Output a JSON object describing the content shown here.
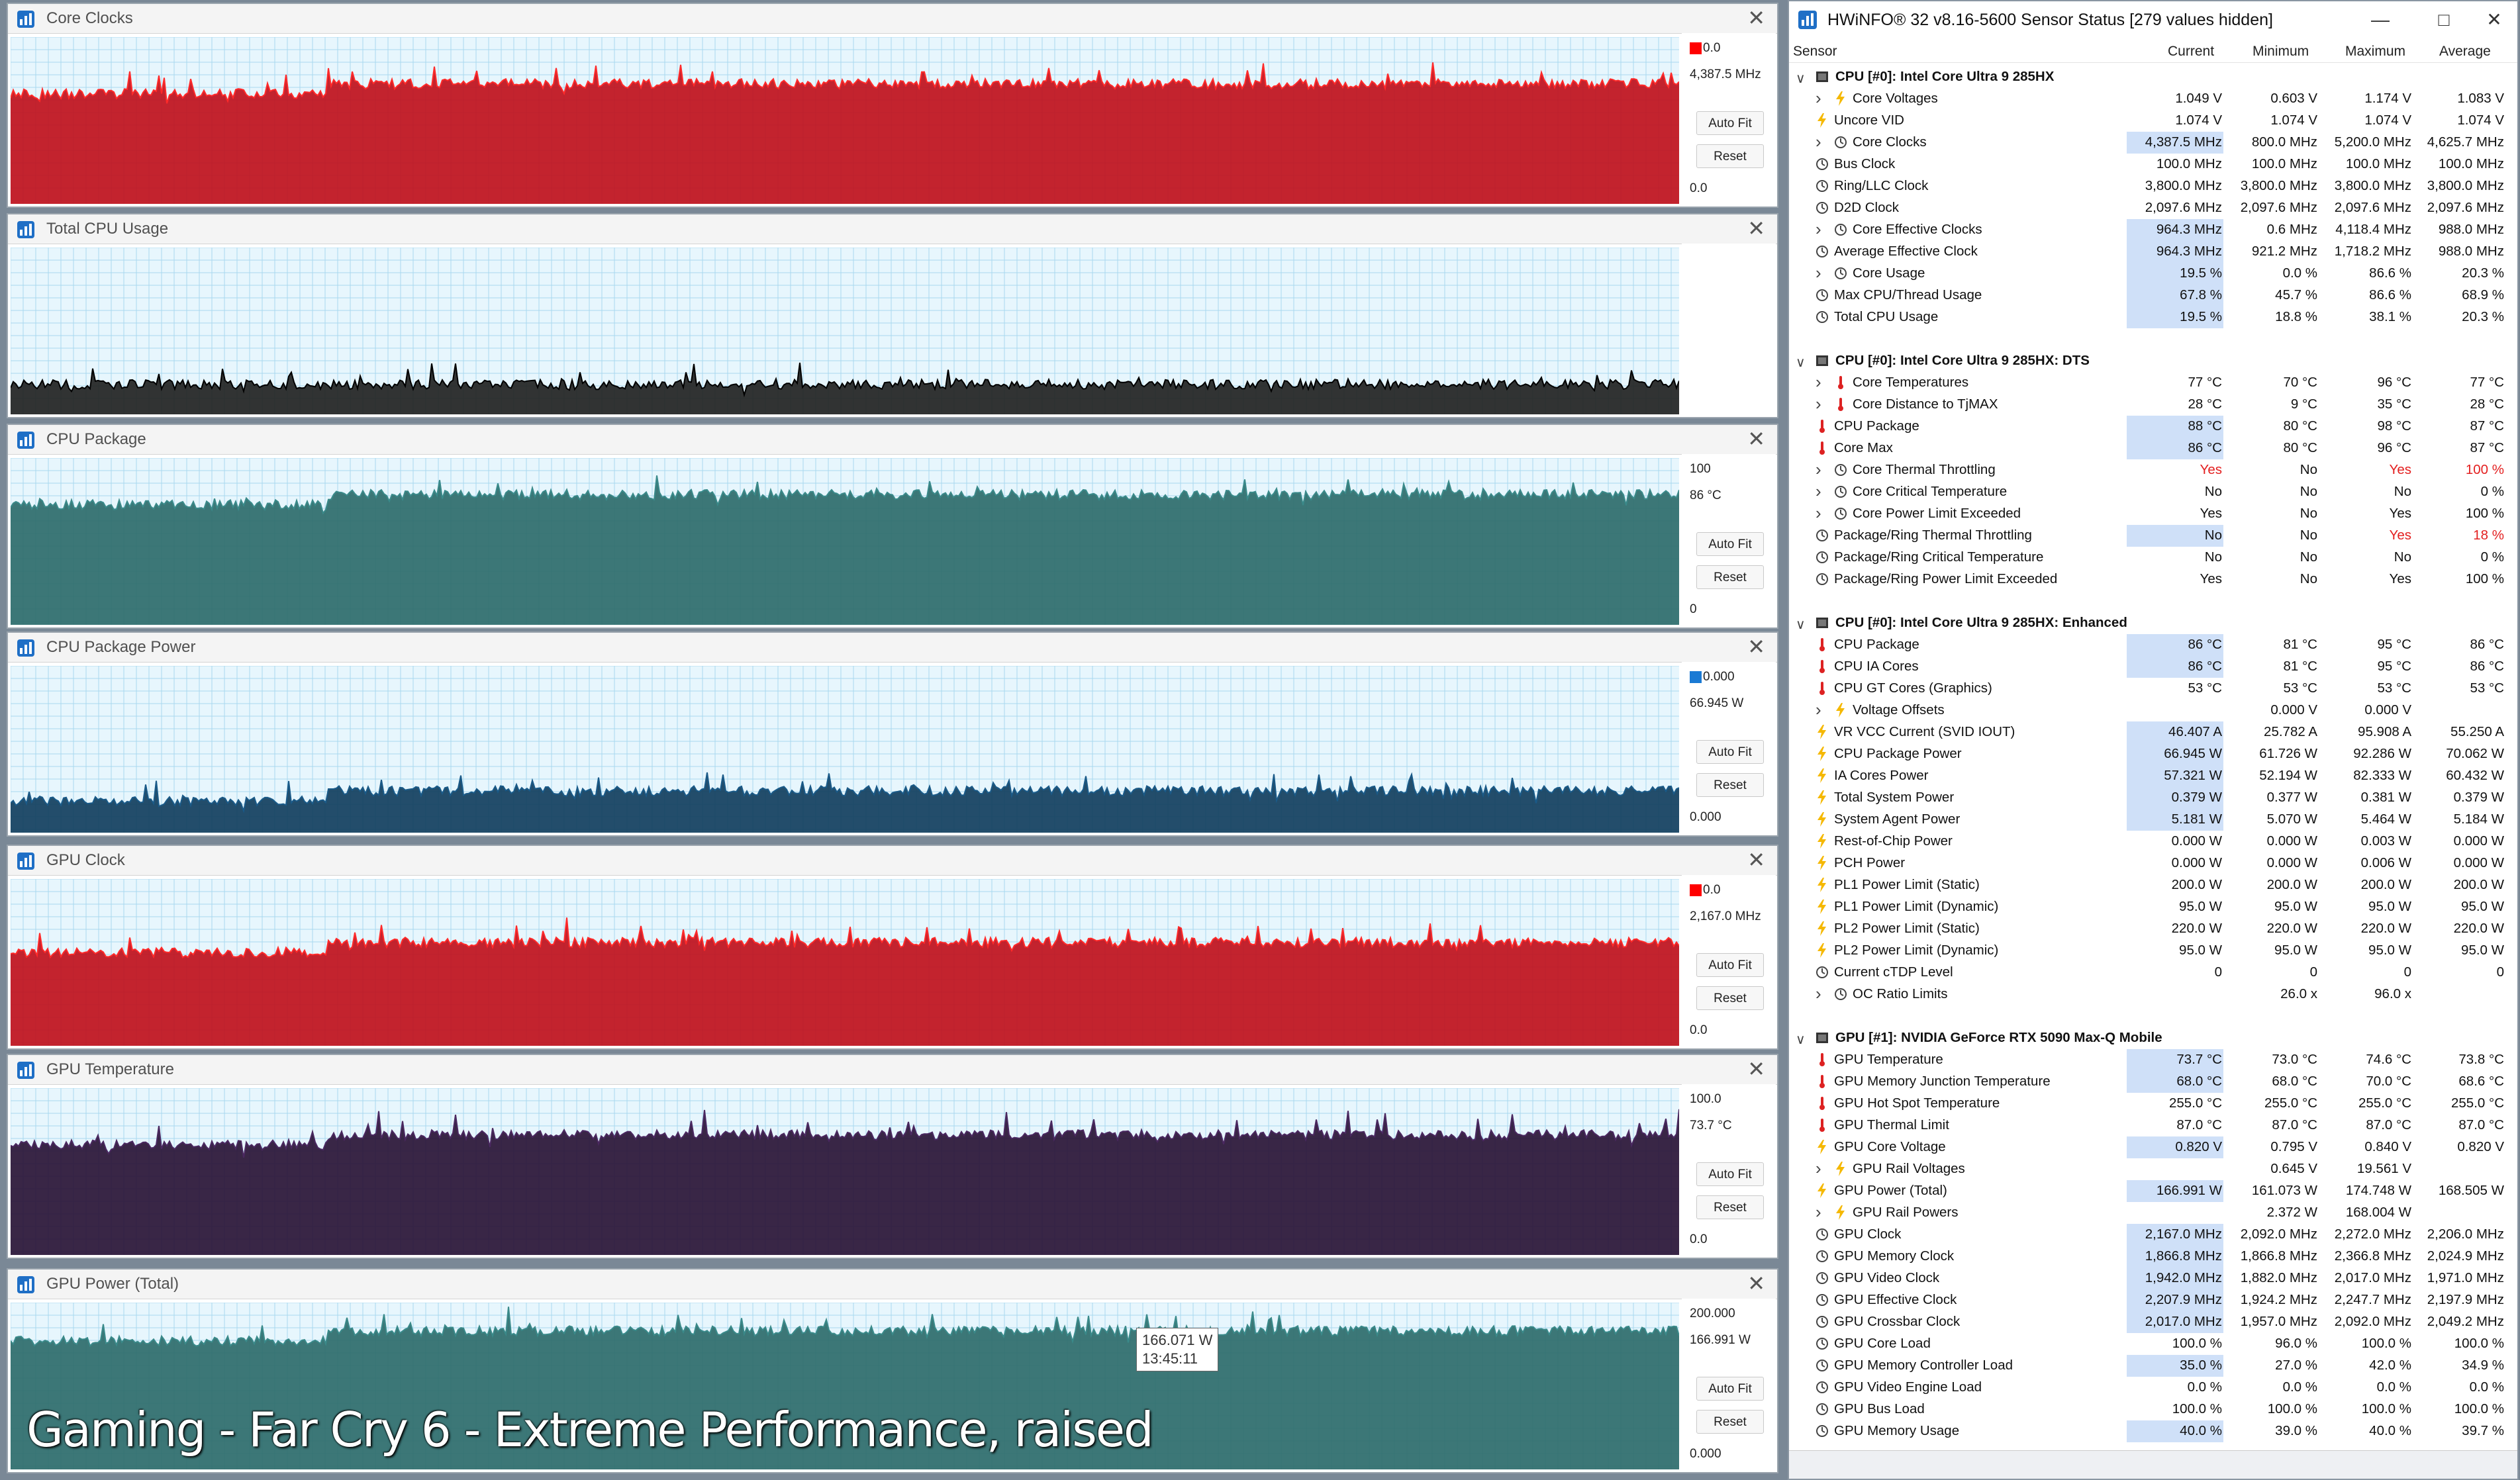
{
  "caption": "Gaming - Far Cry 6 - Extreme Performance, raised",
  "graphs": [
    {
      "name": "Core Clocks",
      "max": "0.0",
      "current": "4,387.5 MHz",
      "min": "0.0",
      "auto_fit": "Auto Fit",
      "reset": "Reset",
      "fill": "#c0101c",
      "line": "#ff2a2a",
      "swatch": "#ff0000",
      "level": 0.72,
      "show_swatch": true
    },
    {
      "name": "Total CPU Usage",
      "max": "",
      "current": "",
      "min": "",
      "auto_fit": "",
      "reset": "",
      "fill": "#222222",
      "line": "#000000",
      "swatch": "",
      "level": 0.18,
      "show_swatch": false
    },
    {
      "name": "CPU Package",
      "max": "100",
      "current": "86 °C",
      "min": "0",
      "auto_fit": "Auto Fit",
      "reset": "Reset",
      "fill": "#2e6b6b",
      "line": "#3a8a8a",
      "swatch": "",
      "level": 0.78,
      "show_swatch": false
    },
    {
      "name": "CPU Package Power",
      "max": "0.000",
      "current": "66.945 W",
      "min": "0.000",
      "auto_fit": "Auto Fit",
      "reset": "Reset",
      "fill": "#123e5e",
      "line": "#1a5a88",
      "swatch": "#1a7ad4",
      "level": 0.25,
      "show_swatch": true
    },
    {
      "name": "GPU Clock",
      "max": "0.0",
      "current": "2,167.0 MHz",
      "min": "0.0",
      "auto_fit": "Auto Fit",
      "reset": "Reset",
      "fill": "#c0101c",
      "line": "#ff2a2a",
      "swatch": "#ff0000",
      "level": 0.62,
      "show_swatch": true
    },
    {
      "name": "GPU Temperature",
      "max": "100.0",
      "current": "73.7 °C",
      "min": "0.0",
      "auto_fit": "Auto Fit",
      "reset": "Reset",
      "fill": "#2a1436",
      "line": "#4a2860",
      "swatch": "",
      "level": 0.72,
      "show_swatch": false
    },
    {
      "name": "GPU Power (Total)",
      "max": "200.000",
      "current": "166.991 W",
      "min": "0.000",
      "auto_fit": "Auto Fit",
      "reset": "Reset",
      "fill": "#2e6b6b",
      "line": "#3a8a8a",
      "swatch": "",
      "level": 0.83,
      "show_swatch": false
    }
  ],
  "tooltip": {
    "value": "166.071 W",
    "time": "13:45:11"
  },
  "sensor": {
    "title": "HWiNFO® 32 v8.16-5600 Sensor Status [279 values hidden]",
    "columns": {
      "sensor": "Sensor",
      "current": "Current",
      "minimum": "Minimum",
      "maximum": "Maximum",
      "average": "Average"
    },
    "rows": [
      {
        "t": "header",
        "label": "CPU [#0]: Intel Core Ultra 9 285HX"
      },
      {
        "t": "volt",
        "ind": 2,
        "label": "Core Voltages",
        "cur": "1.049 V",
        "min": "0.603 V",
        "max": "1.174 V",
        "avg": "1.083 V"
      },
      {
        "t": "volt",
        "ind": 1,
        "label": "Uncore VID",
        "cur": "1.074 V",
        "min": "1.074 V",
        "max": "1.074 V",
        "avg": "1.074 V"
      },
      {
        "t": "clock",
        "ind": 2,
        "label": "Core Clocks",
        "cur": "4,387.5 MHz",
        "min": "800.0 MHz",
        "max": "5,200.0 MHz",
        "avg": "4,625.7 MHz",
        "hl": true
      },
      {
        "t": "clock",
        "ind": 1,
        "label": "Bus Clock",
        "cur": "100.0 MHz",
        "min": "100.0 MHz",
        "max": "100.0 MHz",
        "avg": "100.0 MHz"
      },
      {
        "t": "clock",
        "ind": 1,
        "label": "Ring/LLC Clock",
        "cur": "3,800.0 MHz",
        "min": "3,800.0 MHz",
        "max": "3,800.0 MHz",
        "avg": "3,800.0 MHz"
      },
      {
        "t": "clock",
        "ind": 1,
        "label": "D2D Clock",
        "cur": "2,097.6 MHz",
        "min": "2,097.6 MHz",
        "max": "2,097.6 MHz",
        "avg": "2,097.6 MHz"
      },
      {
        "t": "clock",
        "ind": 2,
        "label": "Core Effective Clocks",
        "cur": "964.3 MHz",
        "min": "0.6 MHz",
        "max": "4,118.4 MHz",
        "avg": "988.0 MHz",
        "hl": true
      },
      {
        "t": "clock",
        "ind": 1,
        "label": "Average Effective Clock",
        "cur": "964.3 MHz",
        "min": "921.2 MHz",
        "max": "1,718.2 MHz",
        "avg": "988.0 MHz",
        "hl": true
      },
      {
        "t": "clock",
        "ind": 2,
        "label": "Core Usage",
        "cur": "19.5 %",
        "min": "0.0 %",
        "max": "86.6 %",
        "avg": "20.3 %",
        "hl": true
      },
      {
        "t": "clock",
        "ind": 1,
        "label": "Max CPU/Thread Usage",
        "cur": "67.8 %",
        "min": "45.7 %",
        "max": "86.6 %",
        "avg": "68.9 %",
        "hl": true
      },
      {
        "t": "clock",
        "ind": 1,
        "label": "Total CPU Usage",
        "cur": "19.5 %",
        "min": "18.8 %",
        "max": "38.1 %",
        "avg": "20.3 %",
        "hl": true
      },
      {
        "t": "blank"
      },
      {
        "t": "header",
        "label": "CPU [#0]: Intel Core Ultra 9 285HX: DTS"
      },
      {
        "t": "temp",
        "ind": 2,
        "label": "Core Temperatures",
        "cur": "77 °C",
        "min": "70 °C",
        "max": "96 °C",
        "avg": "77 °C"
      },
      {
        "t": "temp",
        "ind": 2,
        "label": "Core Distance to TjMAX",
        "cur": "28 °C",
        "min": "9 °C",
        "max": "35 °C",
        "avg": "28 °C"
      },
      {
        "t": "temp",
        "ind": 1,
        "label": "CPU Package",
        "cur": "88 °C",
        "min": "80 °C",
        "max": "98 °C",
        "avg": "87 °C",
        "hl": true
      },
      {
        "t": "temp",
        "ind": 1,
        "label": "Core Max",
        "cur": "86 °C",
        "min": "80 °C",
        "max": "96 °C",
        "avg": "87 °C",
        "hl": true
      },
      {
        "t": "clock",
        "ind": 2,
        "label": "Core Thermal Throttling",
        "cur": "Yes",
        "min": "No",
        "max": "Yes",
        "avg": "100 %",
        "red": [
          true,
          false,
          true,
          true
        ]
      },
      {
        "t": "clock",
        "ind": 2,
        "label": "Core Critical Temperature",
        "cur": "No",
        "min": "No",
        "max": "No",
        "avg": "0 %"
      },
      {
        "t": "clock",
        "ind": 2,
        "label": "Core Power Limit Exceeded",
        "cur": "Yes",
        "min": "No",
        "max": "Yes",
        "avg": "100 %"
      },
      {
        "t": "clock",
        "ind": 1,
        "label": "Package/Ring Thermal Throttling",
        "cur": "No",
        "min": "No",
        "max": "Yes",
        "avg": "18 %",
        "hl": true,
        "red": [
          false,
          false,
          true,
          true
        ]
      },
      {
        "t": "clock",
        "ind": 1,
        "label": "Package/Ring Critical Temperature",
        "cur": "No",
        "min": "No",
        "max": "No",
        "avg": "0 %"
      },
      {
        "t": "clock",
        "ind": 1,
        "label": "Package/Ring Power Limit Exceeded",
        "cur": "Yes",
        "min": "No",
        "max": "Yes",
        "avg": "100 %"
      },
      {
        "t": "blank"
      },
      {
        "t": "header",
        "label": "CPU [#0]: Intel Core Ultra 9 285HX: Enhanced"
      },
      {
        "t": "temp",
        "ind": 1,
        "label": "CPU Package",
        "cur": "86 °C",
        "min": "81 °C",
        "max": "95 °C",
        "avg": "86 °C",
        "hl": true
      },
      {
        "t": "temp",
        "ind": 1,
        "label": "CPU IA Cores",
        "cur": "86 °C",
        "min": "81 °C",
        "max": "95 °C",
        "avg": "86 °C",
        "hl": true
      },
      {
        "t": "temp",
        "ind": 1,
        "label": "CPU GT Cores (Graphics)",
        "cur": "53 °C",
        "min": "53 °C",
        "max": "53 °C",
        "avg": "53 °C"
      },
      {
        "t": "volt",
        "ind": 2,
        "label": "Voltage Offsets",
        "cur": "",
        "min": "0.000 V",
        "max": "0.000 V",
        "avg": ""
      },
      {
        "t": "volt",
        "ind": 1,
        "label": "VR VCC Current (SVID IOUT)",
        "cur": "46.407 A",
        "min": "25.782 A",
        "max": "95.908 A",
        "avg": "55.250 A",
        "hl": true
      },
      {
        "t": "volt",
        "ind": 1,
        "label": "CPU Package Power",
        "cur": "66.945 W",
        "min": "61.726 W",
        "max": "92.286 W",
        "avg": "70.062 W",
        "hl": true
      },
      {
        "t": "volt",
        "ind": 1,
        "label": "IA Cores Power",
        "cur": "57.321 W",
        "min": "52.194 W",
        "max": "82.333 W",
        "avg": "60.432 W",
        "hl": true
      },
      {
        "t": "volt",
        "ind": 1,
        "label": "Total System Power",
        "cur": "0.379 W",
        "min": "0.377 W",
        "max": "0.381 W",
        "avg": "0.379 W",
        "hl": true
      },
      {
        "t": "volt",
        "ind": 1,
        "label": "System Agent Power",
        "cur": "5.181 W",
        "min": "5.070 W",
        "max": "5.464 W",
        "avg": "5.184 W",
        "hl": true
      },
      {
        "t": "volt",
        "ind": 1,
        "label": "Rest-of-Chip Power",
        "cur": "0.000 W",
        "min": "0.000 W",
        "max": "0.003 W",
        "avg": "0.000 W"
      },
      {
        "t": "volt",
        "ind": 1,
        "label": "PCH Power",
        "cur": "0.000 W",
        "min": "0.000 W",
        "max": "0.006 W",
        "avg": "0.000 W"
      },
      {
        "t": "volt",
        "ind": 1,
        "label": "PL1 Power Limit (Static)",
        "cur": "200.0 W",
        "min": "200.0 W",
        "max": "200.0 W",
        "avg": "200.0 W"
      },
      {
        "t": "volt",
        "ind": 1,
        "label": "PL1 Power Limit (Dynamic)",
        "cur": "95.0 W",
        "min": "95.0 W",
        "max": "95.0 W",
        "avg": "95.0 W"
      },
      {
        "t": "volt",
        "ind": 1,
        "label": "PL2 Power Limit (Static)",
        "cur": "220.0 W",
        "min": "220.0 W",
        "max": "220.0 W",
        "avg": "220.0 W"
      },
      {
        "t": "volt",
        "ind": 1,
        "label": "PL2 Power Limit (Dynamic)",
        "cur": "95.0 W",
        "min": "95.0 W",
        "max": "95.0 W",
        "avg": "95.0 W"
      },
      {
        "t": "clock",
        "ind": 1,
        "label": "Current cTDP Level",
        "cur": "0",
        "min": "0",
        "max": "0",
        "avg": "0"
      },
      {
        "t": "clock",
        "ind": 2,
        "label": "OC Ratio Limits",
        "cur": "",
        "min": "26.0 x",
        "max": "96.0 x",
        "avg": ""
      },
      {
        "t": "blank"
      },
      {
        "t": "header",
        "label": "GPU [#1]: NVIDIA  GeForce RTX 5090 Max-Q Mobile"
      },
      {
        "t": "temp",
        "ind": 1,
        "label": "GPU Temperature",
        "cur": "73.7 °C",
        "min": "73.0 °C",
        "max": "74.6 °C",
        "avg": "73.8 °C",
        "hl": true
      },
      {
        "t": "temp",
        "ind": 1,
        "label": "GPU Memory Junction Temperature",
        "cur": "68.0 °C",
        "min": "68.0 °C",
        "max": "70.0 °C",
        "avg": "68.6 °C",
        "hl": true
      },
      {
        "t": "temp",
        "ind": 1,
        "label": "GPU Hot Spot Temperature",
        "cur": "255.0 °C",
        "min": "255.0 °C",
        "max": "255.0 °C",
        "avg": "255.0 °C"
      },
      {
        "t": "temp",
        "ind": 1,
        "label": "GPU Thermal Limit",
        "cur": "87.0 °C",
        "min": "87.0 °C",
        "max": "87.0 °C",
        "avg": "87.0 °C"
      },
      {
        "t": "volt",
        "ind": 1,
        "label": "GPU Core Voltage",
        "cur": "0.820 V",
        "min": "0.795 V",
        "max": "0.840 V",
        "avg": "0.820 V",
        "hl": true
      },
      {
        "t": "volt",
        "ind": 2,
        "label": "GPU Rail Voltages",
        "cur": "",
        "min": "0.645 V",
        "max": "19.561 V",
        "avg": ""
      },
      {
        "t": "volt",
        "ind": 1,
        "label": "GPU Power (Total)",
        "cur": "166.991 W",
        "min": "161.073 W",
        "max": "174.748 W",
        "avg": "168.505 W",
        "hl": true
      },
      {
        "t": "volt",
        "ind": 2,
        "label": "GPU Rail Powers",
        "cur": "",
        "min": "2.372 W",
        "max": "168.004 W",
        "avg": ""
      },
      {
        "t": "clock",
        "ind": 1,
        "label": "GPU Clock",
        "cur": "2,167.0 MHz",
        "min": "2,092.0 MHz",
        "max": "2,272.0 MHz",
        "avg": "2,206.0 MHz",
        "hl": true
      },
      {
        "t": "clock",
        "ind": 1,
        "label": "GPU Memory Clock",
        "cur": "1,866.8 MHz",
        "min": "1,866.8 MHz",
        "max": "2,366.8 MHz",
        "avg": "2,024.9 MHz",
        "hl": true
      },
      {
        "t": "clock",
        "ind": 1,
        "label": "GPU Video Clock",
        "cur": "1,942.0 MHz",
        "min": "1,882.0 MHz",
        "max": "2,017.0 MHz",
        "avg": "1,971.0 MHz",
        "hl": true
      },
      {
        "t": "clock",
        "ind": 1,
        "label": "GPU Effective Clock",
        "cur": "2,207.9 MHz",
        "min": "1,924.2 MHz",
        "max": "2,247.7 MHz",
        "avg": "2,197.9 MHz",
        "hl": true
      },
      {
        "t": "clock",
        "ind": 1,
        "label": "GPU Crossbar Clock",
        "cur": "2,017.0 MHz",
        "min": "1,957.0 MHz",
        "max": "2,092.0 MHz",
        "avg": "2,049.2 MHz",
        "hl": true
      },
      {
        "t": "clock",
        "ind": 1,
        "label": "GPU Core Load",
        "cur": "100.0 %",
        "min": "96.0 %",
        "max": "100.0 %",
        "avg": "100.0 %"
      },
      {
        "t": "clock",
        "ind": 1,
        "label": "GPU Memory Controller Load",
        "cur": "35.0 %",
        "min": "27.0 %",
        "max": "42.0 %",
        "avg": "34.9 %",
        "hl": true
      },
      {
        "t": "clock",
        "ind": 1,
        "label": "GPU Video Engine Load",
        "cur": "0.0 %",
        "min": "0.0 %",
        "max": "0.0 %",
        "avg": "0.0 %"
      },
      {
        "t": "clock",
        "ind": 1,
        "label": "GPU Bus Load",
        "cur": "100.0 %",
        "min": "100.0 %",
        "max": "100.0 %",
        "avg": "100.0 %"
      },
      {
        "t": "clock",
        "ind": 1,
        "label": "GPU Memory Usage",
        "cur": "40.0 %",
        "min": "39.0 %",
        "max": "40.0 %",
        "avg": "39.7 %",
        "hl": true
      }
    ]
  }
}
